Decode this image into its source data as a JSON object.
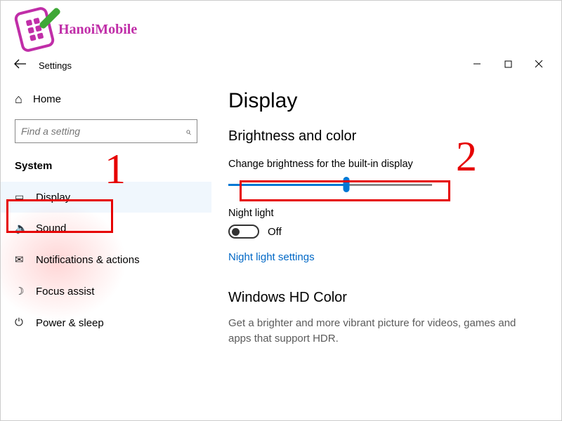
{
  "watermark": {
    "text": "HanoiMobile"
  },
  "titlebar": {
    "title": "Settings"
  },
  "sidebar": {
    "home_label": "Home",
    "search_placeholder": "Find a setting",
    "section_label": "System",
    "items": [
      {
        "icon": "display-icon",
        "label": "Display",
        "active": true
      },
      {
        "icon": "sound-icon",
        "label": "Sound"
      },
      {
        "icon": "notifications-icon",
        "label": "Notifications & actions"
      },
      {
        "icon": "focus-assist-icon",
        "label": "Focus assist"
      },
      {
        "icon": "power-sleep-icon",
        "label": "Power & sleep"
      }
    ]
  },
  "main": {
    "heading": "Display",
    "section1_heading": "Brightness and color",
    "brightness_label": "Change brightness for the built-in display",
    "brightness_percent": 58,
    "night_light_label": "Night light",
    "night_light_state": "Off",
    "night_light_link": "Night light settings",
    "section2_heading": "Windows HD Color",
    "section2_desc": "Get a brighter and more vibrant picture for videos, games and apps that support HDR."
  },
  "annotations": {
    "num1": "1",
    "num2": "2"
  }
}
